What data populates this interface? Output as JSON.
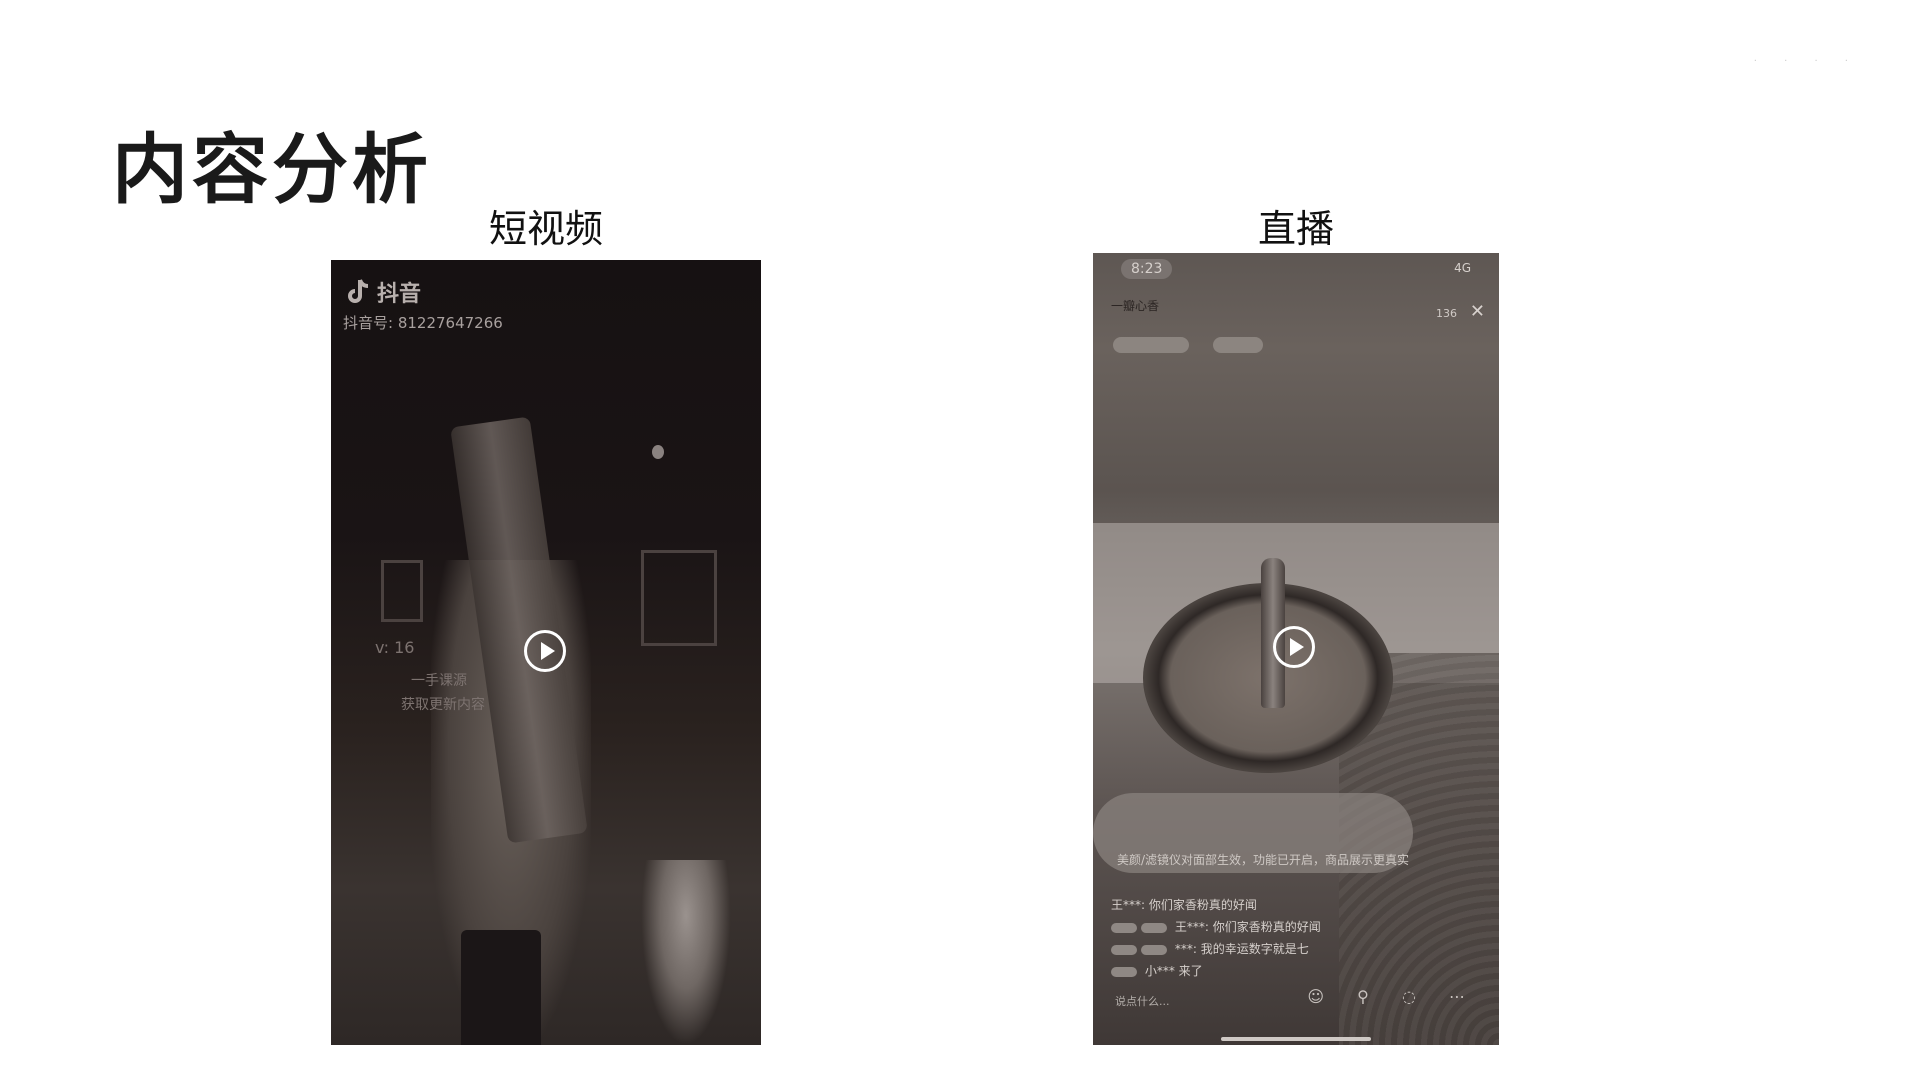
{
  "slide": {
    "title": "内容分析"
  },
  "columns": [
    {
      "label": "短视频"
    },
    {
      "label": "直播"
    }
  ],
  "short_video": {
    "app_name": "抖音",
    "account_id": "抖音号: 81227647266",
    "overlay_lines": [
      "v: 16",
      "一手课源",
      "获取更新内容"
    ]
  },
  "live": {
    "time": "8:23",
    "network": "4G",
    "anchor_name": "一瓣心香",
    "viewer_count": "136",
    "notice": "美颜/滤镜仪对面部生效，功能已开启，商品展示更真实",
    "chat": [
      {
        "user": "王***",
        "text": "你们家香粉真的好闻"
      },
      {
        "user": "王***",
        "text": "你们家香粉真的好闻"
      },
      {
        "user": "***",
        "text": "我的幸运数字就是七"
      },
      {
        "user": "小***",
        "text": "来了"
      }
    ],
    "input_placeholder": "说点什么..."
  }
}
